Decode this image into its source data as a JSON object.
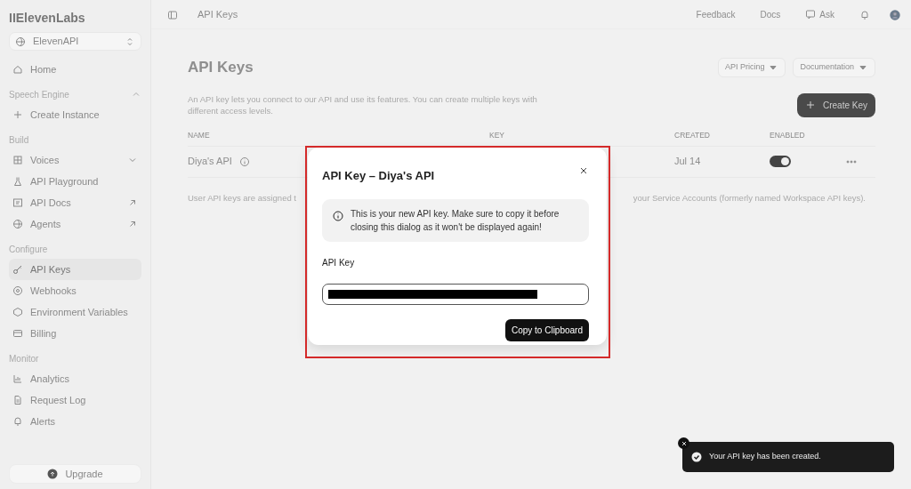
{
  "logo": "IIElevenLabs",
  "workspace": {
    "label": "ElevenAPI"
  },
  "sidebar": {
    "groups": [
      {
        "items": [
          {
            "label": "Home",
            "selected": false
          }
        ]
      },
      {
        "title": "Speech Engine",
        "items": [
          {
            "label": "Create Instance",
            "selected": false
          }
        ]
      },
      {
        "title": "Build",
        "items": [
          {
            "label": "Voices",
            "selected": false
          },
          {
            "label": "API Playground",
            "selected": false
          },
          {
            "label": "API Docs",
            "selected": false
          },
          {
            "label": "Agents",
            "selected": false
          }
        ]
      },
      {
        "title": "Configure",
        "items": [
          {
            "label": "API Keys",
            "selected": true
          },
          {
            "label": "Webhooks",
            "selected": false
          },
          {
            "label": "Environment Variables",
            "selected": false
          },
          {
            "label": "Billing",
            "selected": false
          }
        ]
      },
      {
        "title": "Monitor",
        "items": [
          {
            "label": "Analytics",
            "selected": false
          },
          {
            "label": "Request Log",
            "selected": false
          },
          {
            "label": "Alerts",
            "selected": false
          }
        ]
      }
    ],
    "upgrade": "Upgrade"
  },
  "topbar": {
    "breadcrumb": "API Keys",
    "links": [
      "Feedback",
      "Docs",
      "Ask"
    ]
  },
  "page": {
    "title": "API Keys",
    "actions": [
      "API Pricing",
      "Documentation"
    ],
    "description": "An API key lets you connect to our API and use its features. You can create multiple keys with different access levels.",
    "create_button": "Create Key"
  },
  "table": {
    "columns": [
      "NAME",
      "KEY",
      "CREATED",
      "ENABLED"
    ],
    "rows": [
      {
        "name": "Diya's API",
        "created": "Jul 14",
        "enabled": true
      }
    ]
  },
  "note": {
    "visible_start": "User API keys are assigned t",
    "visible_end": "your Service Accounts (formerly named Workspace API keys)."
  },
  "dialog": {
    "title": "API Key – Diya's API",
    "info": "This is your new API key. Make sure to copy it before closing this dialog as it won't be displayed again!",
    "field_label": "API Key",
    "button": "Copy to Clipboard"
  },
  "toast": {
    "message": "Your API key has been created."
  }
}
